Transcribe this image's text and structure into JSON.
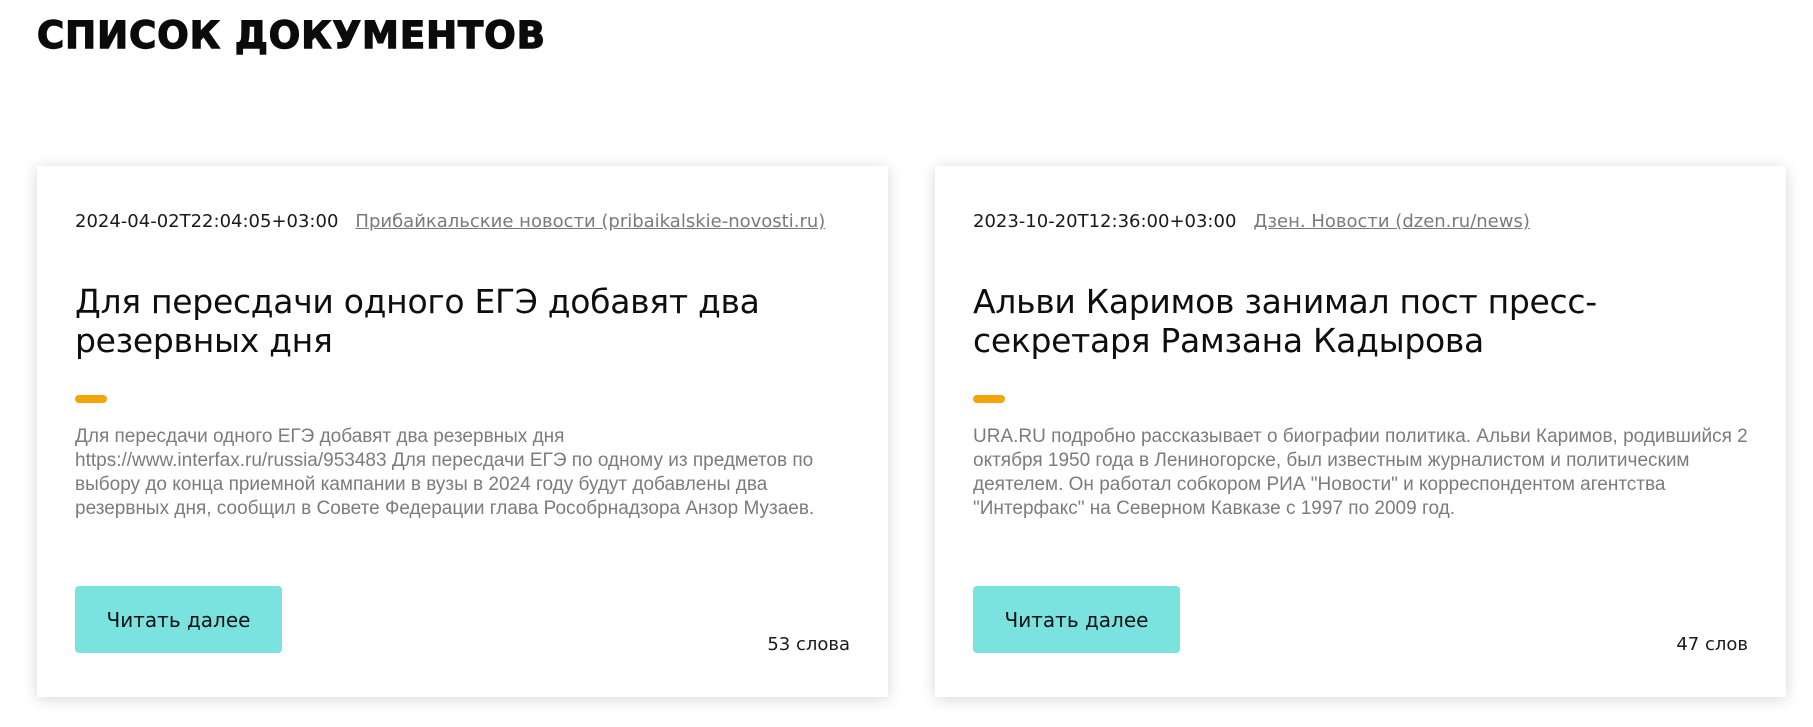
{
  "page": {
    "title": "Список документов"
  },
  "documents": [
    {
      "date": "2024-04-02T22:04:05+03:00",
      "source": "Прибайкальские новости (pribaikalskie-novosti.ru)",
      "title": "Для пересдачи одного ЕГЭ добавят два резервных дня",
      "summary": "Для пересдачи одного ЕГЭ добавят два резервных дня https://www.interfax.ru/russia/953483 Для пересдачи ЕГЭ по одному из предметов по выбору до конца приемной кампании в вузы в 2024 году будут добавлены два резервных дня, сообщил в Совете Федерации глава Рособрнадзора Анзор Музаев.",
      "button_label": "Читать далее",
      "word_count": "53 слова"
    },
    {
      "date": "2023-10-20T12:36:00+03:00",
      "source": "Дзен. Новости (dzen.ru/news)",
      "title": "Альви Каримов занимал пост пресс-секретаря Рамзана Кадырова",
      "summary": "URA.RU подробно рассказывает о биографии политика. Альви Каримов, родившийся 2 октября 1950 года в Лениногорске, был известным журналистом и политическим деятелем. Он работал собкором РИА \"Новости\" и корреспондентом агентства \"Интерфакс\" на Северном Кавказе с 1997 по 2009 год.",
      "button_label": "Читать далее",
      "word_count": "47 слов"
    }
  ],
  "colors": {
    "accent": "#f5a50a",
    "button": "#7ae3df",
    "summary_text": "#7c7c7c",
    "source_link": "#7a7a7a"
  }
}
